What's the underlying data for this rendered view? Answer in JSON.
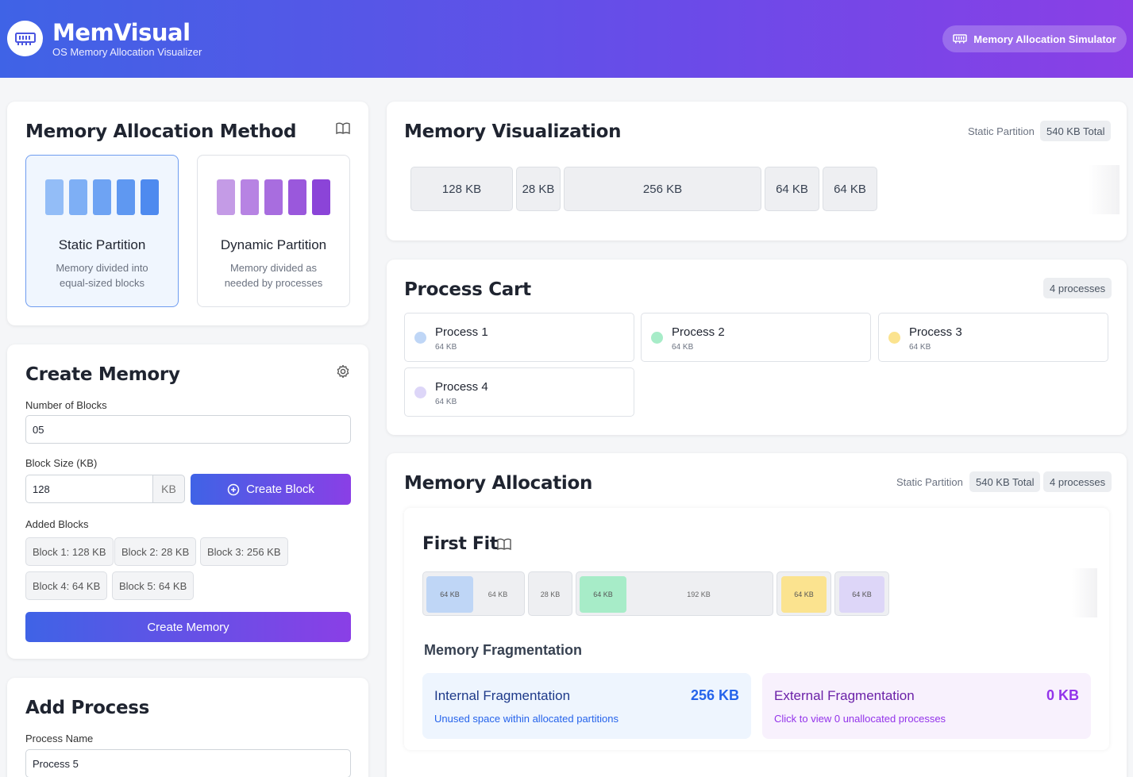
{
  "header": {
    "title": "MemVisual",
    "subtitle": "OS Memory Allocation Visualizer",
    "pill_label": "Memory Allocation Simulator"
  },
  "method_card": {
    "title": "Memory Allocation Method",
    "options": [
      {
        "name": "Static Partition",
        "desc": "Memory divided into equal-sized blocks",
        "selected": true
      },
      {
        "name": "Dynamic Partition",
        "desc": "Memory divided as needed by processes",
        "selected": false
      }
    ]
  },
  "create_memory": {
    "title": "Create Memory",
    "blocks_label": "Number of Blocks",
    "blocks_value": "05",
    "size_label": "Block Size (KB)",
    "size_value": "128",
    "unit": "KB",
    "create_block_label": "Create Block",
    "added_label": "Added Blocks",
    "added_blocks": [
      "Block 1: 128 KB",
      "Block 2: 28 KB",
      "Block 3: 256 KB",
      "Block 4: 64 KB",
      "Block 5: 64 KB"
    ],
    "create_memory_label": "Create Memory"
  },
  "add_process": {
    "title": "Add Process",
    "name_label": "Process Name",
    "name_value": "Process 5"
  },
  "visualization": {
    "title": "Memory Visualization",
    "mode": "Static Partition",
    "total": "540 KB Total",
    "blocks": [
      "128 KB",
      "28 KB",
      "256 KB",
      "64 KB",
      "64 KB"
    ]
  },
  "process_cart": {
    "title": "Process Cart",
    "count": "4 processes",
    "processes": [
      {
        "name": "Process 1",
        "size": "64 KB",
        "color": "#bfd6f6"
      },
      {
        "name": "Process 2",
        "size": "64 KB",
        "color": "#a7ecc8"
      },
      {
        "name": "Process 3",
        "size": "64 KB",
        "color": "#fbe38f"
      },
      {
        "name": "Process 4",
        "size": "64 KB",
        "color": "#ddd6f8"
      }
    ]
  },
  "allocation": {
    "title": "Memory Allocation",
    "mode": "Static Partition",
    "total": "540 KB Total",
    "count": "4 processes",
    "algorithm": "First Fit",
    "segments": {
      "b1_used": "64 KB",
      "b1_free": "64 KB",
      "b2_free": "28 KB",
      "b3_used": "64 KB",
      "b3_free": "192 KB",
      "b4_used": "64 KB",
      "b5_used": "64 KB"
    },
    "fragmentation_title": "Memory Fragmentation",
    "internal": {
      "title": "Internal Fragmentation",
      "value": "256 KB",
      "desc": "Unused space within allocated partitions"
    },
    "external": {
      "title": "External Fragmentation",
      "value": "0 KB",
      "desc": "Click to view 0 unallocated processes"
    }
  }
}
